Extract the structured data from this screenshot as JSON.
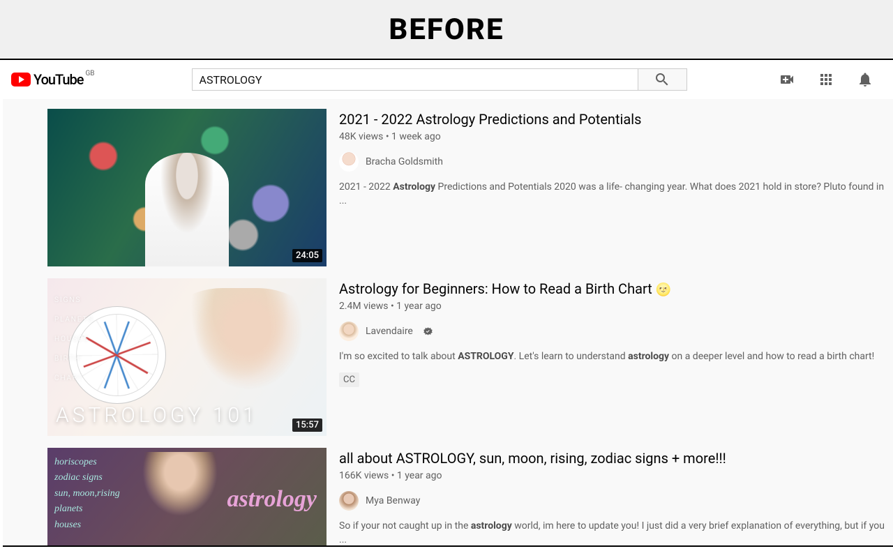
{
  "banner": {
    "label": "BEFORE"
  },
  "logo": {
    "brand": "YouTube",
    "region": "GB"
  },
  "search": {
    "value": "ASTROLOGY"
  },
  "results": [
    {
      "title": "2021 - 2022 Astrology Predictions and Potentials",
      "views": "48K views",
      "age": "1 week ago",
      "channel": "Bracha Goldsmith",
      "verified": false,
      "duration": "24:05",
      "desc_pre": "2021 - 2022 ",
      "desc_bold1": "Astrology",
      "desc_mid": " Predictions and Potentials 2020 was a life- changing year. What does 2021 hold in store? Pluto found in ...",
      "cc": false
    },
    {
      "title": "Astrology for Beginners: How to Read a Birth Chart ",
      "emoji": "🌝",
      "views": "2.4M views",
      "age": "1 year ago",
      "channel": "Lavendaire",
      "verified": true,
      "duration": "15:57",
      "desc_pre": "I'm so excited to talk about ",
      "desc_bold1": "ASTROLOGY",
      "desc_mid": ". Let's learn to understand ",
      "desc_bold2": "astrology",
      "desc_post": " on a deeper level and how to read a birth chart!",
      "cc": true,
      "cc_label": "CC",
      "thumb_labels": "SIGNS\nPLANETS\nHOUSES\nBIRTH\nCHART",
      "thumb_title": "ASTROLOGY 101"
    },
    {
      "title": "all about ASTROLOGY, sun, moon, rising, zodiac signs + more!!!",
      "views": "166K views",
      "age": "1 year ago",
      "channel": "Mya Benway",
      "verified": false,
      "desc_pre": "So if your not caught up in the ",
      "desc_bold1": "astrology",
      "desc_mid": " world, im here to update you! I just did a very brief explanation of everything, but if you ...",
      "cc": false,
      "thumb_left": "horiscopes\nzodiac signs\nsun, moon,rising\nplanets\nhouses",
      "thumb_word": "astrology"
    }
  ]
}
